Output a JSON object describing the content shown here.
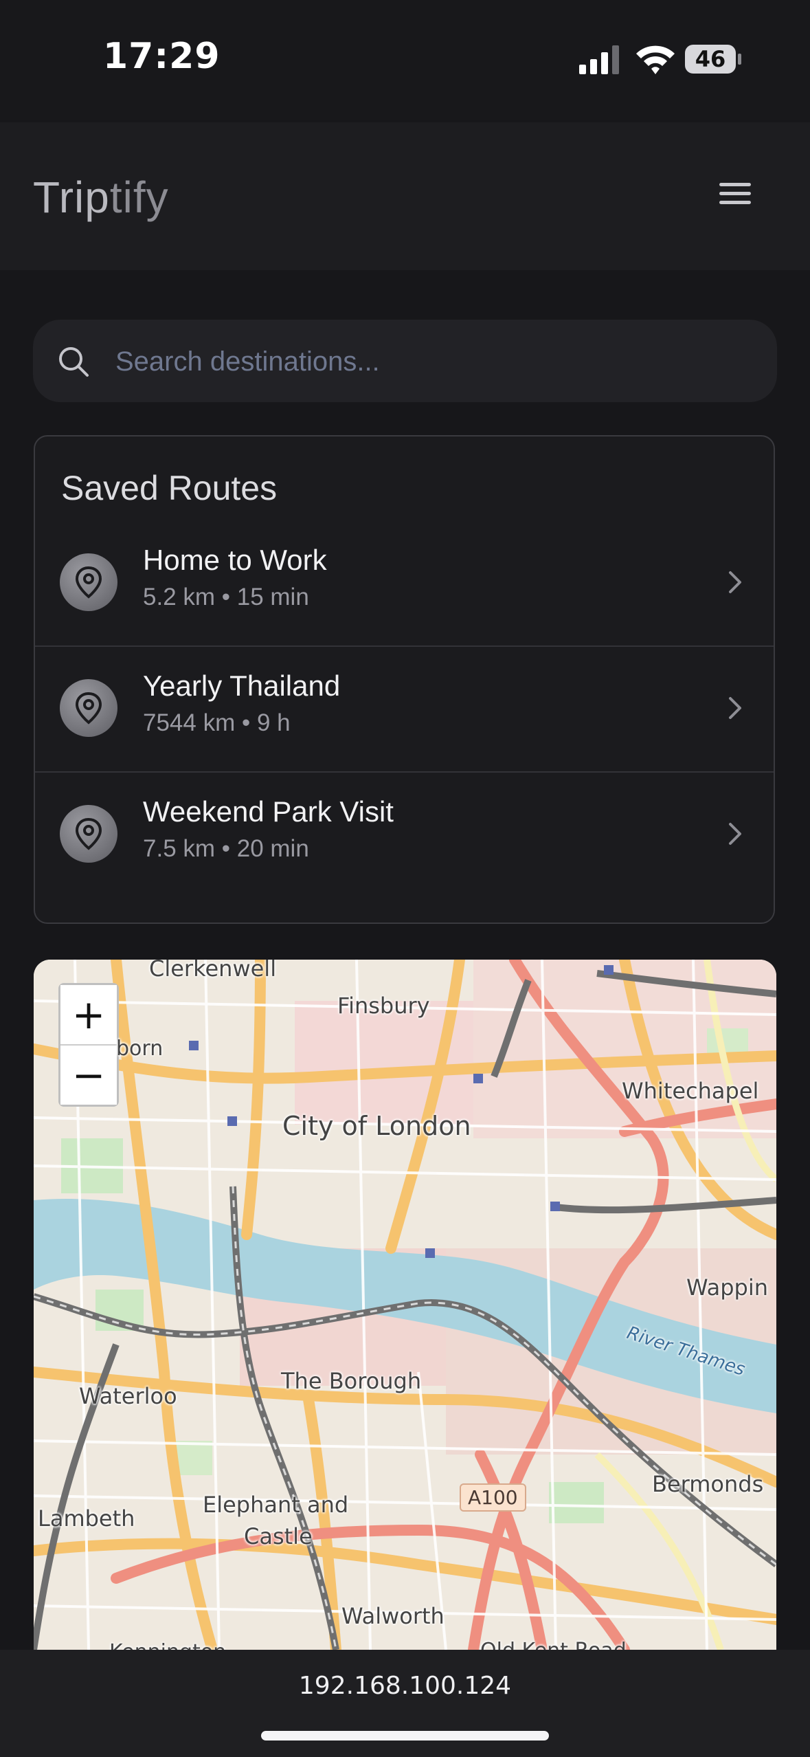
{
  "status_bar": {
    "time": "17:29",
    "battery": "46"
  },
  "header": {
    "brand_main": "Trip",
    "brand_fade": "tify"
  },
  "search": {
    "placeholder": "Search destinations..."
  },
  "saved_routes": {
    "title": "Saved Routes",
    "items": [
      {
        "name": "Home to Work",
        "meta": "5.2 km • 15 min"
      },
      {
        "name": "Yearly Thailand",
        "meta": "7544 km • 9 h"
      },
      {
        "name": "Weekend Park Visit",
        "meta": "7.5 km • 20 min"
      }
    ]
  },
  "map": {
    "zoom_in": "+",
    "zoom_out": "−",
    "labels": {
      "clerkenwell": "Clerkenwell",
      "finsbury": "Finsbury",
      "holborn": "born",
      "whitechapel": "Whitechapel",
      "city": "City of London",
      "wapping": "Wappin",
      "thames": "River Thames",
      "waterloo": "Waterloo",
      "borough": "The Borough",
      "bermondsey": "Bermonds",
      "lambeth": "Lambeth",
      "elephant1": "Elephant and",
      "elephant2": "Castle",
      "walworth": "Walworth",
      "kennington": "Kennington",
      "oldkent": "Old Kent Road",
      "a100": "A100"
    }
  },
  "browser": {
    "url": "192.168.100.124"
  }
}
